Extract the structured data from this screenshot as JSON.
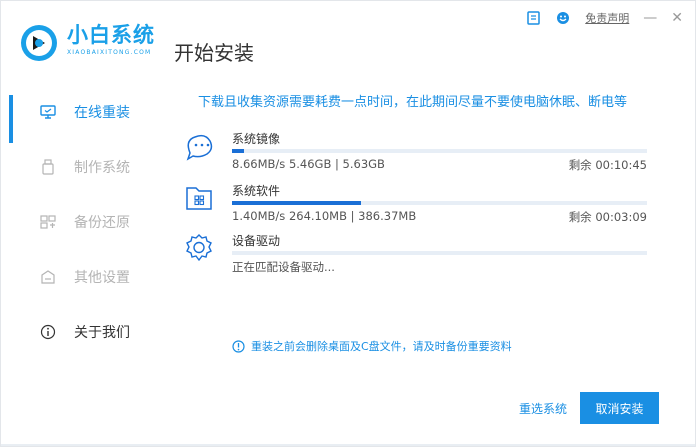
{
  "header": {
    "brand_name": "小白系统",
    "brand_sub": "XIAOBAIXITONG.COM",
    "page_title": "开始安装",
    "disclaimer": "免责声明",
    "minimize": "—",
    "close": "✕"
  },
  "sidebar": {
    "items": [
      {
        "label": "在线重装",
        "icon": "monitor-icon",
        "active": true
      },
      {
        "label": "制作系统",
        "icon": "usb-icon",
        "active": false
      },
      {
        "label": "备份还原",
        "icon": "backup-icon",
        "active": false
      },
      {
        "label": "其他设置",
        "icon": "settings-box-icon",
        "active": false
      },
      {
        "label": "关于我们",
        "icon": "info-icon",
        "active": false
      }
    ]
  },
  "main": {
    "notice": "下载且收集资源需要耗费一点时间，在此期间尽量不要使电脑休眠、断电等",
    "tasks": [
      {
        "name": "系统镜像",
        "stats": "8.66MB/s 5.46GB | 5.63GB",
        "remaining": "剩余 00:10:45",
        "progress": 0.03,
        "icon": "disc-face-icon"
      },
      {
        "name": "系统软件",
        "stats": "1.40MB/s 264.10MB | 386.37MB",
        "remaining": "剩余 00:03:09",
        "progress": 0.31,
        "icon": "software-folder-icon"
      },
      {
        "name": "设备驱动",
        "stats": "正在匹配设备驱动...",
        "remaining": "",
        "progress": 0.0,
        "icon": "gear-icon"
      }
    ],
    "warning": "重装之前会删除桌面及C盘文件，请及时备份重要资料"
  },
  "footer": {
    "reselect": "重选系统",
    "cancel": "取消安装"
  },
  "colors": {
    "accent": "#1a8fe3",
    "brand": "#1aa0e8",
    "progress": "#1a6fd6"
  }
}
